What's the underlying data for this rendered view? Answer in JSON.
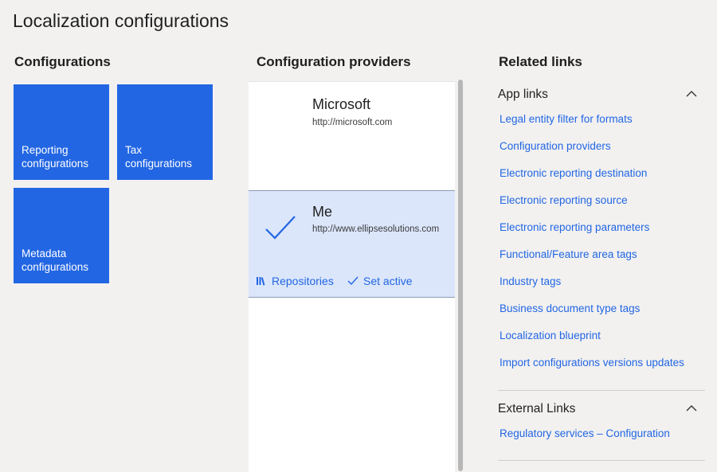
{
  "page": {
    "title": "Localization configurations"
  },
  "configurations": {
    "heading": "Configurations",
    "tiles": [
      {
        "line1": "Reporting",
        "line2": "configurations"
      },
      {
        "line1": "Tax",
        "line2": "configurations"
      },
      {
        "line1": "Metadata",
        "line2": "configurations"
      }
    ]
  },
  "providers": {
    "heading": "Configuration providers",
    "items": [
      {
        "name": "Microsoft",
        "url": "http://microsoft.com"
      },
      {
        "name": "Me",
        "url": "http://www.ellipsesolutions.com",
        "active": true
      }
    ],
    "actions": {
      "repositories": "Repositories",
      "set_active": "Set active"
    }
  },
  "related": {
    "heading": "Related links",
    "app_links": {
      "heading": "App links",
      "links": [
        "Legal entity filter for formats",
        "Configuration providers",
        "Electronic reporting destination",
        "Electronic reporting source",
        "Electronic reporting parameters",
        "Functional/Feature area tags",
        "Industry tags",
        "Business document type tags",
        "Localization blueprint",
        "Import configurations versions updates"
      ]
    },
    "external_links": {
      "heading": "External Links",
      "links": [
        "Regulatory services – Configuration"
      ]
    }
  },
  "colors": {
    "accent": "#2266e3",
    "selected_bg": "#dbe6fb",
    "page_bg": "#f2f1f0"
  },
  "icons": {
    "check": "checkmark-icon",
    "repositories": "library-icon",
    "collapse": "chevron-up-icon"
  }
}
